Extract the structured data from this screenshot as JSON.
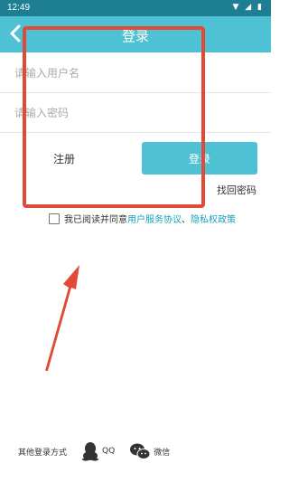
{
  "status_bar": {
    "time": "12:49"
  },
  "header": {
    "title": "登录"
  },
  "form": {
    "username_placeholder": "请输入用户名",
    "password_placeholder": "请输入密码",
    "register_label": "注册",
    "login_label": "登录",
    "forgot_label": "找回密码"
  },
  "agreement": {
    "prefix": "我已阅读并同意",
    "service_link": "用户服务协议",
    "separator": "、",
    "privacy_link": "隐私权政策"
  },
  "other_login": {
    "label": "其他登录方式",
    "qq_label": "QQ",
    "wechat_label": "微信"
  },
  "colors": {
    "accent": "#4ec2d4",
    "annotation": "#e04a36"
  }
}
